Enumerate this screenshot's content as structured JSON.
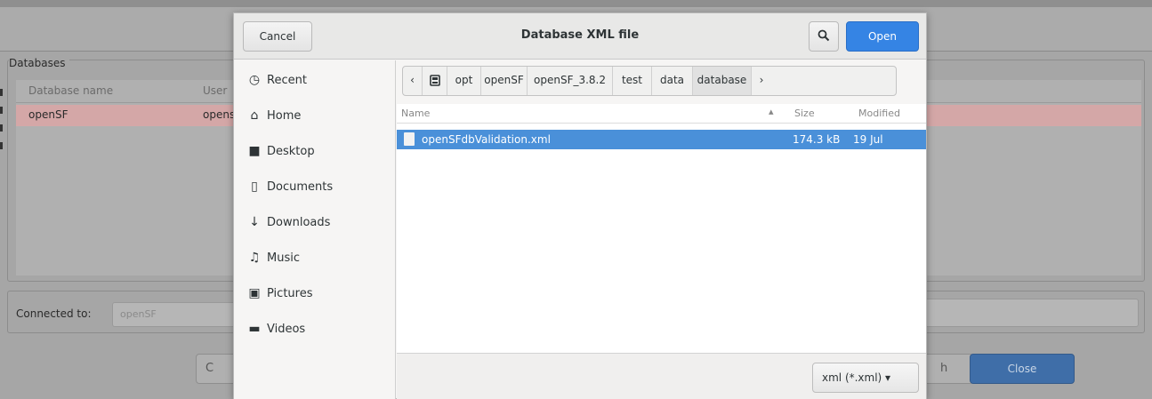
{
  "background": {
    "databases_frame_title": "Databases",
    "table_headers": [
      "Database name",
      "User"
    ],
    "selected_row": [
      "openSF",
      "opens"
    ],
    "connected_label": "Connected to:",
    "connected_value": "openSF",
    "left_button_fragment": "C",
    "mid_button_fragment": "h",
    "close_button": "Close"
  },
  "dialog": {
    "title": "Database XML file",
    "cancel_label": "Cancel",
    "open_label": "Open",
    "search_icon": "search-icon",
    "sidebar": [
      {
        "label": "Recent",
        "icon": "clock-icon",
        "glyph": "◷"
      },
      {
        "label": "Home",
        "icon": "home-icon",
        "glyph": "⌂"
      },
      {
        "label": "Desktop",
        "icon": "folder-icon",
        "glyph": "■"
      },
      {
        "label": "Documents",
        "icon": "document-icon",
        "glyph": "▯"
      },
      {
        "label": "Downloads",
        "icon": "download-icon",
        "glyph": "↓"
      },
      {
        "label": "Music",
        "icon": "music-icon",
        "glyph": "♫"
      },
      {
        "label": "Pictures",
        "icon": "camera-icon",
        "glyph": "▣"
      },
      {
        "label": "Videos",
        "icon": "video-icon",
        "glyph": "▬"
      }
    ],
    "pathbar": {
      "crumbs": [
        "opt",
        "openSF",
        "openSF_3.8.2",
        "test",
        "data",
        "database"
      ],
      "active": "database"
    },
    "columns": {
      "name": "Name",
      "size": "Size",
      "modified": "Modified"
    },
    "files": [
      {
        "name": "openSFdbValidation.xml",
        "size": "174.3 kB",
        "modified": "19 Jul",
        "selected": true
      }
    ],
    "filter": "xml (*.xml) ▾"
  },
  "colors": {
    "accent": "#3584e4",
    "selection": "#4a90d9",
    "highlight_row": "#d4a7a7"
  }
}
